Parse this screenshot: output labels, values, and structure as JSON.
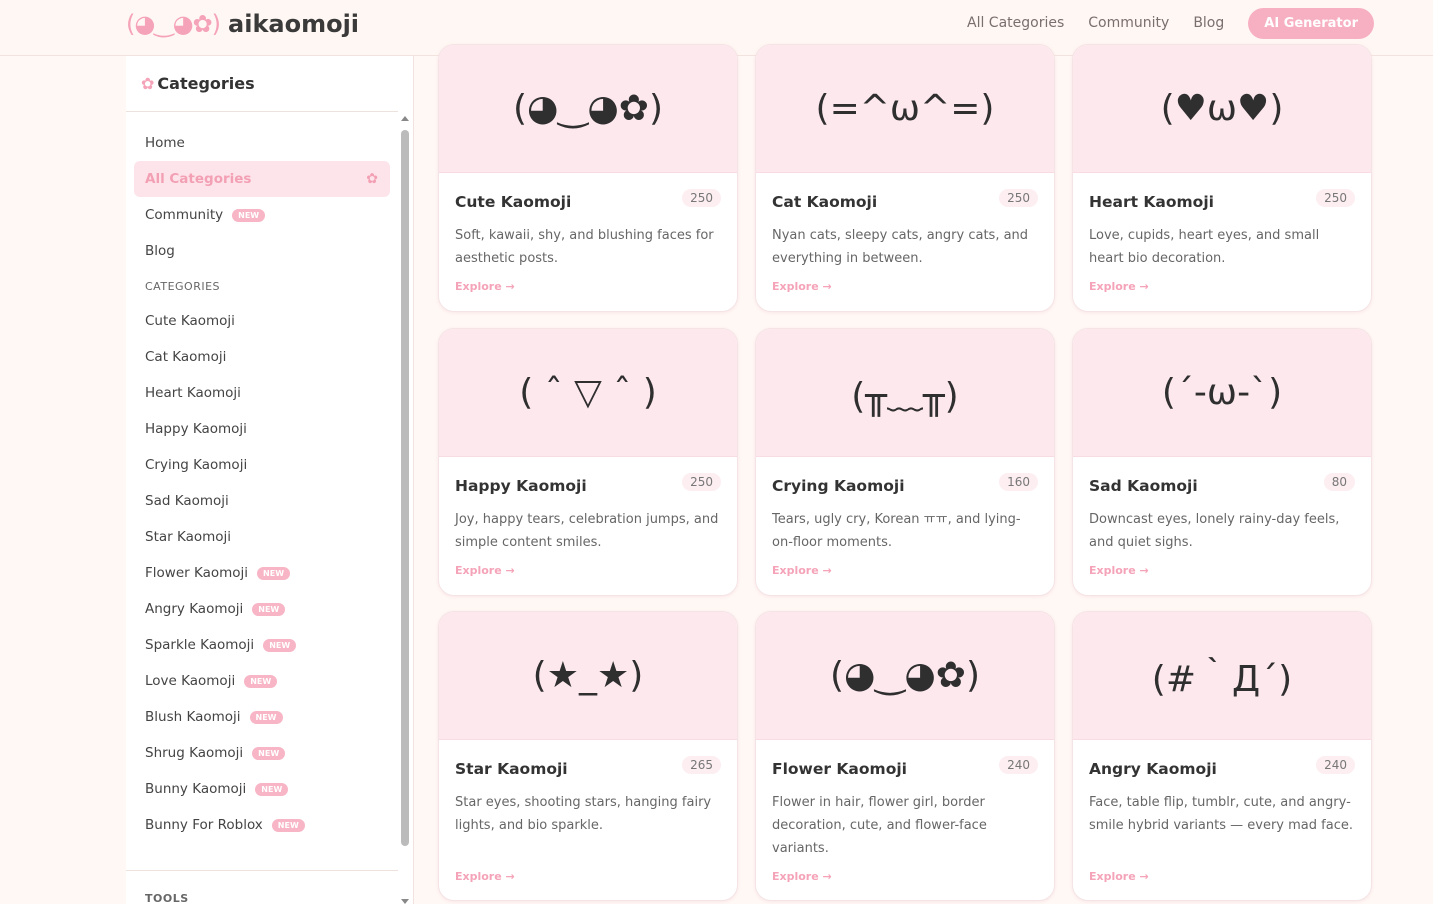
{
  "header": {
    "logo_face": "(◕‿◕✿)",
    "logo_text": "aikaomoji",
    "nav": [
      "All Categories",
      "Community",
      "Blog"
    ],
    "ai_button": "AI Generator"
  },
  "sidebar": {
    "title": "Categories",
    "items": [
      {
        "label": "Home"
      },
      {
        "label": "All Categories"
      },
      {
        "label": "Community",
        "badge": "NEW"
      },
      {
        "label": "Blog"
      }
    ],
    "section_label": "CATEGORIES",
    "categories": [
      {
        "label": "Cute Kaomoji"
      },
      {
        "label": "Cat Kaomoji"
      },
      {
        "label": "Heart Kaomoji"
      },
      {
        "label": "Happy Kaomoji"
      },
      {
        "label": "Crying Kaomoji"
      },
      {
        "label": "Sad Kaomoji"
      },
      {
        "label": "Star Kaomoji"
      },
      {
        "label": "Flower Kaomoji",
        "badge": "NEW"
      },
      {
        "label": "Angry Kaomoji",
        "badge": "NEW"
      },
      {
        "label": "Sparkle Kaomoji",
        "badge": "NEW"
      },
      {
        "label": "Love Kaomoji",
        "badge": "NEW"
      },
      {
        "label": "Blush Kaomoji",
        "badge": "NEW"
      },
      {
        "label": "Shrug Kaomoji",
        "badge": "NEW"
      },
      {
        "label": "Bunny Kaomoji",
        "badge": "NEW"
      },
      {
        "label": "Bunny For Roblox",
        "badge": "NEW"
      }
    ],
    "tools_label": "TOOLS"
  },
  "cards": [
    {
      "face": "(◕‿◕✿)",
      "name": "Cute Kaomoji",
      "count": "250",
      "desc": "Soft, kawaii, shy, and blushing faces for aesthetic posts.",
      "explore": "Explore →"
    },
    {
      "face": "(=^ω^=)",
      "name": "Cat Kaomoji",
      "count": "250",
      "desc": "Nyan cats, sleepy cats, angry cats, and everything in between.",
      "explore": "Explore →"
    },
    {
      "face": "(♥ω♥)",
      "name": "Heart Kaomoji",
      "count": "250",
      "desc": "Love, cupids, heart eyes, and small heart bio decoration.",
      "explore": "Explore →"
    },
    {
      "face": "( ˆ ▽ ˆ )",
      "name": "Happy Kaomoji",
      "count": "250",
      "desc": "Joy, happy tears, celebration jumps, and simple content smiles.",
      "explore": "Explore →"
    },
    {
      "face": "(╥﹏╥)",
      "name": "Crying Kaomoji",
      "count": "160",
      "desc": "Tears, ugly cry, Korean ㅠㅠ, and lying-on-floor moments.",
      "explore": "Explore →"
    },
    {
      "face": "(´-ω-`)",
      "name": "Sad Kaomoji",
      "count": "80",
      "desc": "Downcast eyes, lonely rainy-day feels, and quiet sighs.",
      "explore": "Explore →"
    },
    {
      "face": "(★_★)",
      "name": "Star Kaomoji",
      "count": "265",
      "desc": "Star eyes, shooting stars, hanging fairy lights, and bio sparkle.",
      "explore": "Explore →"
    },
    {
      "face": "(◕‿◕✿)",
      "name": "Flower Kaomoji",
      "count": "240",
      "desc": "Flower in hair, flower girl, border decoration, cute, and flower-face variants.",
      "explore": "Explore →"
    },
    {
      "face": "(#｀Д´)",
      "name": "Angry Kaomoji",
      "count": "240",
      "desc": "Face, table flip, tumblr, cute, and angry-smile hybrid variants — every mad face.",
      "explore": "Explore →"
    }
  ],
  "colors": {
    "accent": "#f7b0c2",
    "card_top": "#fde8ee",
    "background": "#fff8f5"
  }
}
